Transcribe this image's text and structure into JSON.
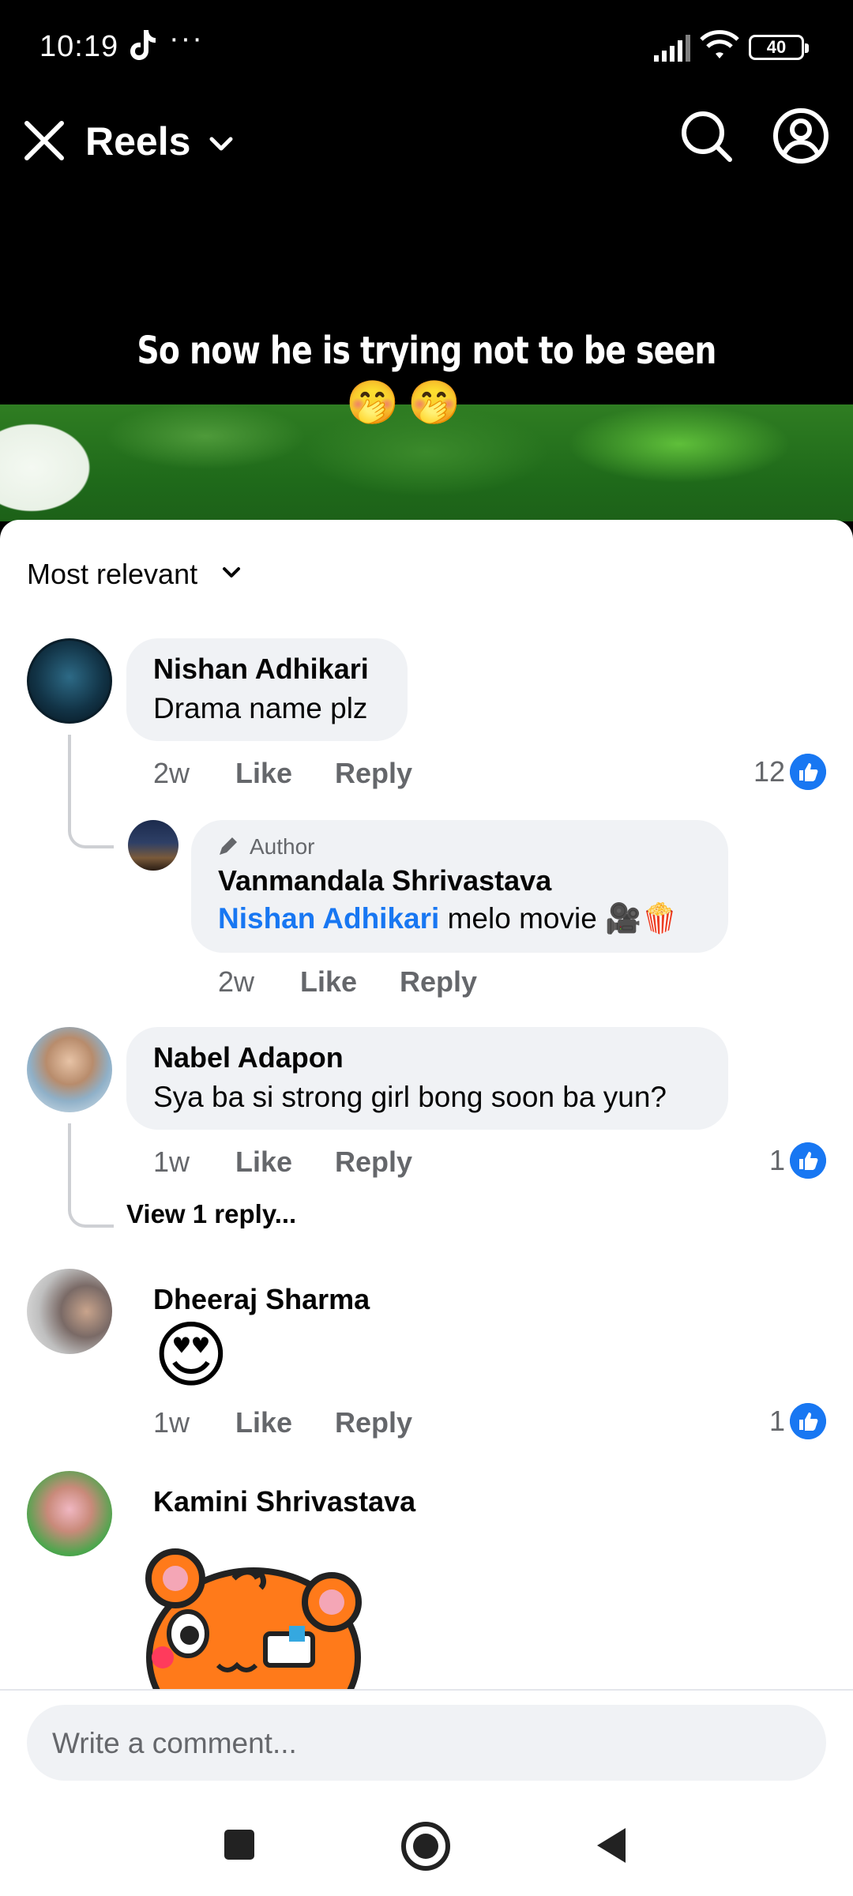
{
  "status": {
    "time": "10:19",
    "more": "···",
    "battery": "40"
  },
  "header": {
    "title": "Reels"
  },
  "video": {
    "caption": "So now he is trying not to be seen",
    "caption_emoji": "🤭"
  },
  "comments": {
    "sort_label": "Most relevant",
    "actions": {
      "like": "Like",
      "reply": "Reply"
    },
    "items": [
      {
        "name": "Nishan Adhikari",
        "text": "Drama name plz",
        "time": "2w",
        "likes": "12"
      },
      {
        "name": "Vanmandala Shrivastava",
        "author_label": "Author",
        "mention": "Nishan Adhikari",
        "text": " melo movie 🎥🍿",
        "time": "2w"
      },
      {
        "name": "Nabel Adapon",
        "text": "Sya ba si strong girl bong soon ba yun?",
        "time": "1w",
        "likes": "1",
        "view_replies": "View 1 reply..."
      },
      {
        "name": "Dheeraj Sharma",
        "emoji": "😍",
        "time": "1w",
        "likes": "1"
      },
      {
        "name": "Kamini Shrivastava"
      }
    ]
  },
  "composer": {
    "placeholder": "Write a comment..."
  },
  "colors": {
    "accent": "#1877f2",
    "bubble": "#f0f2f5",
    "secondary_text": "#65676b"
  }
}
